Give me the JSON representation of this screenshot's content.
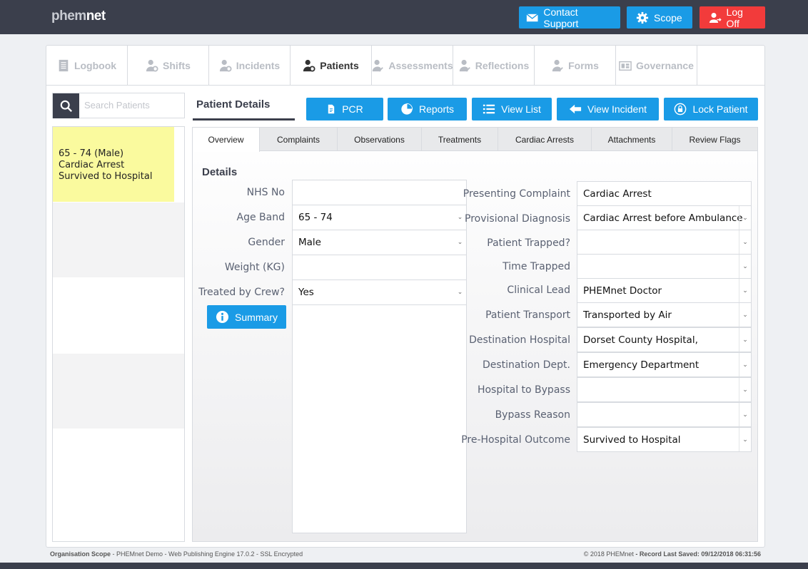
{
  "app": {
    "logo_a": "phem",
    "logo_b": "net"
  },
  "header": {
    "contact_support": "Contact Support",
    "scope": "Scope",
    "log_off": "Log Off"
  },
  "nav_tabs": [
    {
      "label": "Logbook",
      "icon": "book-icon"
    },
    {
      "label": "Shifts",
      "icon": "user-gear-icon"
    },
    {
      "label": "Incidents",
      "icon": "user-gear-icon"
    },
    {
      "label": "Patients",
      "icon": "user-gear-icon",
      "active": true
    },
    {
      "label": "Assessments",
      "icon": "user-check-icon"
    },
    {
      "label": "Reflections",
      "icon": "user-check-icon"
    },
    {
      "label": "Forms",
      "icon": "user-check-icon"
    },
    {
      "label": "Governance",
      "icon": "governance-icon"
    }
  ],
  "search": {
    "placeholder": "Search Patients"
  },
  "patient_list": [
    {
      "line1": "65 - 74 (Male)",
      "line2": "Cardiac Arrest",
      "line3": "Survived to Hospital"
    }
  ],
  "patient_details_title": "Patient Details",
  "actions": {
    "pcr": "PCR",
    "reports": "Reports",
    "view_list": "View List",
    "view_incident": "View Incident",
    "lock_patient": "Lock Patient"
  },
  "sub_tabs": [
    "Overview",
    "Complaints",
    "Observations",
    "Treatments",
    "Cardiac Arrests",
    "Attachments",
    "Review Flags"
  ],
  "details_heading": "Details",
  "left_fields": {
    "nhs_no": {
      "label": "NHS No",
      "value": ""
    },
    "age_band": {
      "label": "Age Band",
      "value": "65 - 74"
    },
    "gender": {
      "label": "Gender",
      "value": "Male"
    },
    "weight": {
      "label": "Weight (KG)",
      "value": ""
    },
    "treated": {
      "label": "Treated by Crew?",
      "value": "Yes"
    }
  },
  "summary_button": "Summary",
  "right_fields": {
    "presenting": {
      "label": "Presenting Complaint",
      "value": "Cardiac Arrest"
    },
    "provisional": {
      "label": "Provisional Diagnosis",
      "value": "Cardiac Arrest before Ambulance"
    },
    "trapped": {
      "label": "Patient Trapped?",
      "value": ""
    },
    "time_trapped": {
      "label": "Time Trapped",
      "value": ""
    },
    "clinical_lead": {
      "label": "Clinical Lead",
      "value": "PHEMnet Doctor"
    },
    "transport": {
      "label": "Patient Transport",
      "value": "Transported by Air"
    },
    "dest_hospital": {
      "label": "Destination Hospital",
      "value": "Dorset County Hospital,"
    },
    "dest_dept": {
      "label": "Destination Dept.",
      "value": "Emergency Department"
    },
    "bypass_hospital": {
      "label": "Hospital to Bypass",
      "value": ""
    },
    "bypass_reason": {
      "label": "Bypass Reason",
      "value": ""
    },
    "outcome": {
      "label": "Pre-Hospital Outcome",
      "value": "Survived to Hospital"
    }
  },
  "footer": {
    "scope_label": "Organisation Scope",
    "scope_text": " - PHEMnet Demo - Web Publishing Engine 17.0.2 - SSL Encrypted",
    "copyright": "© 2018 PHEMnet",
    "saved_label": " - Record Last Saved: 09/12/2018 06:31:56"
  }
}
